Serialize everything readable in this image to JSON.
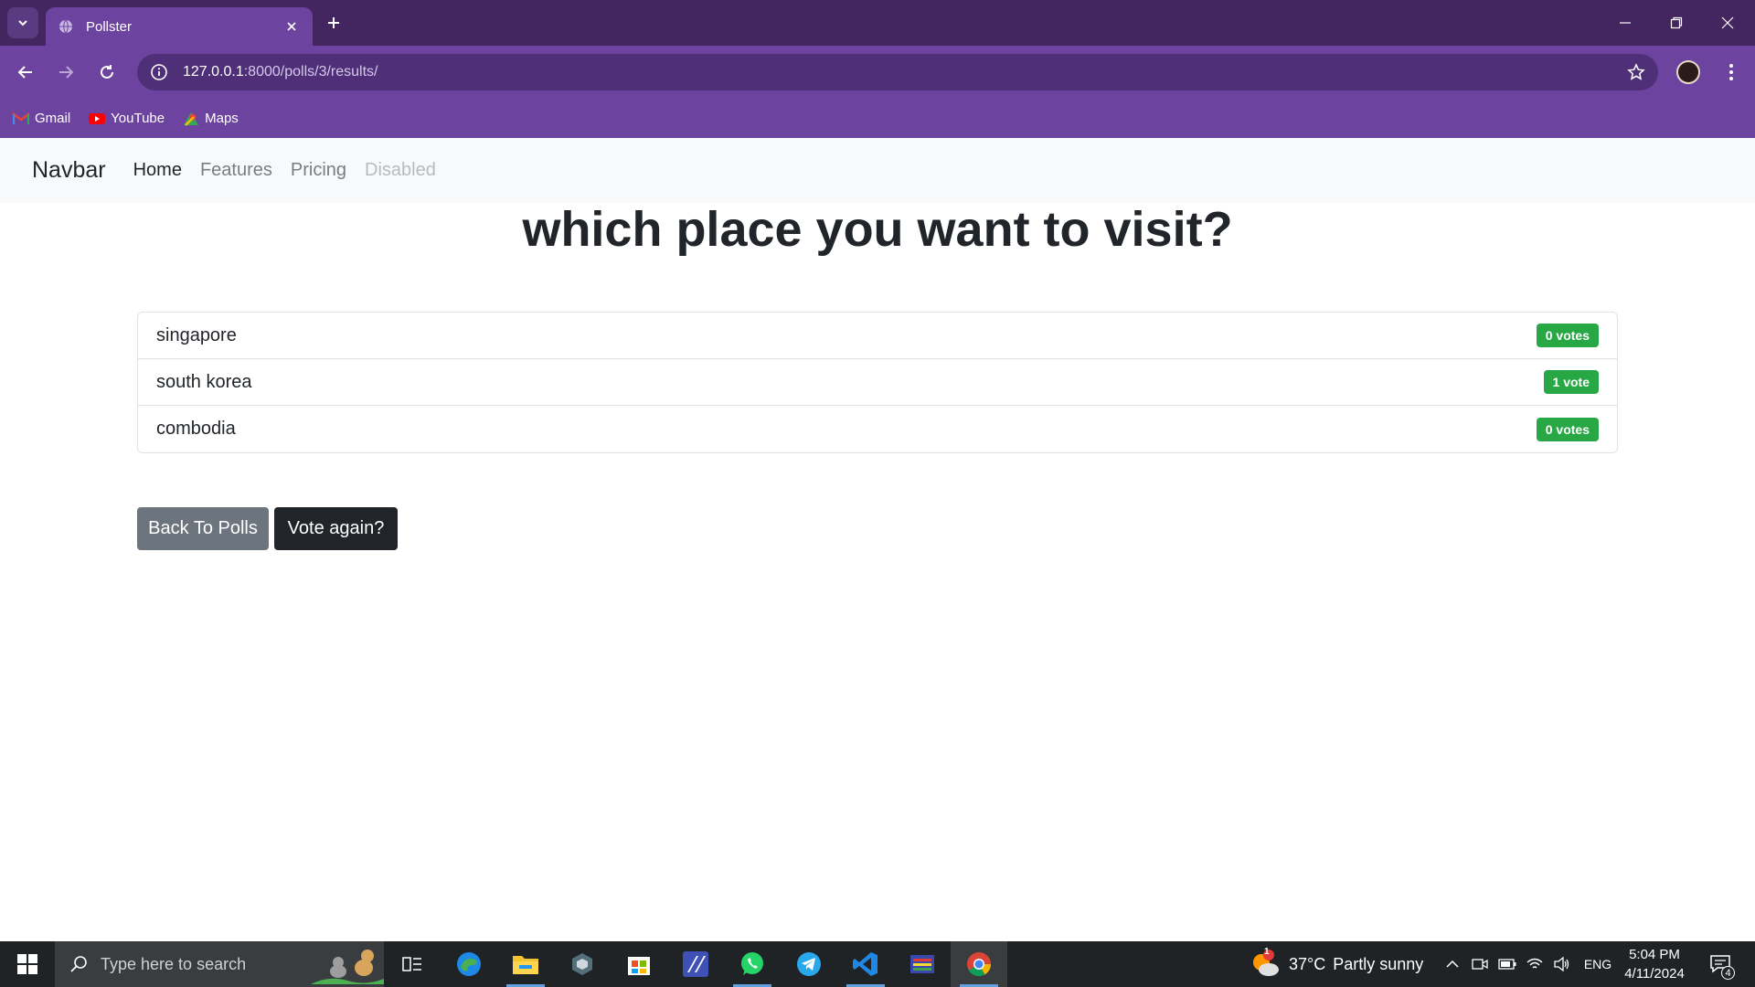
{
  "browser": {
    "tab_title": "Pollster",
    "url_host": "127.0.0.1",
    "url_path": ":8000/polls/3/results/",
    "bookmarks": [
      {
        "label": "Gmail",
        "icon": "gmail-icon"
      },
      {
        "label": "YouTube",
        "icon": "youtube-icon"
      },
      {
        "label": "Maps",
        "icon": "maps-icon"
      }
    ],
    "colors": {
      "frame": "#43265f",
      "toolbar": "#6d43a0"
    }
  },
  "navbar": {
    "brand": "Navbar",
    "links": [
      {
        "label": "Home",
        "state": "active"
      },
      {
        "label": "Features",
        "state": "normal"
      },
      {
        "label": "Pricing",
        "state": "normal"
      },
      {
        "label": "Disabled",
        "state": "disabled"
      }
    ]
  },
  "poll": {
    "question": "which place you want to visit?",
    "choices": [
      {
        "text": "singapore",
        "votes": "0 votes"
      },
      {
        "text": "south korea",
        "votes": "1 vote"
      },
      {
        "text": "combodia",
        "votes": "0 votes"
      }
    ],
    "badge_color": "#28a745"
  },
  "actions": {
    "back_label": "Back To Polls",
    "vote_label": "Vote again?"
  },
  "taskbar": {
    "search_placeholder": "Type here to search",
    "weather_temp": "37°C",
    "weather_text": "Partly sunny",
    "weather_alert": "1",
    "language": "ENG",
    "time": "5:04 PM",
    "date": "4/11/2024",
    "notifications": "4",
    "apps": [
      "task-view-icon",
      "edge-icon",
      "file-explorer-icon",
      "app-icon",
      "store-icon",
      "app-icon",
      "whatsapp-icon",
      "telegram-icon",
      "vscode-icon",
      "app-icon",
      "chrome-icon"
    ]
  }
}
